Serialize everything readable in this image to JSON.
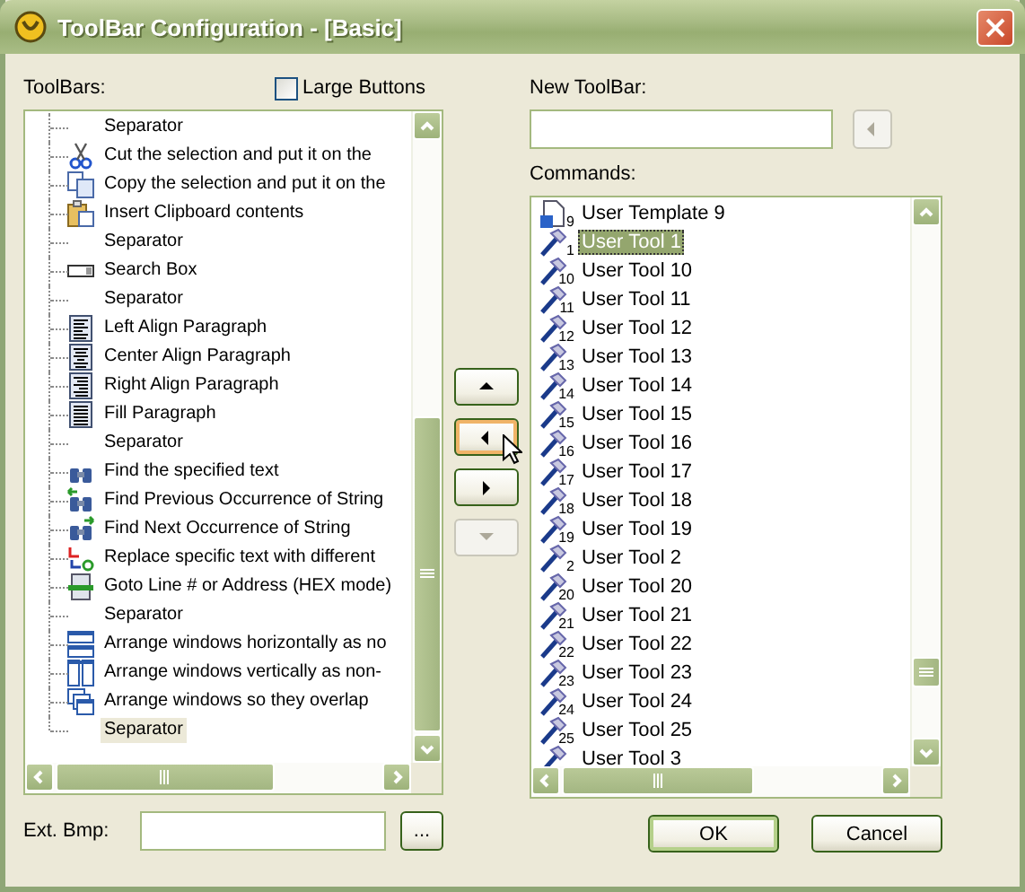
{
  "window": {
    "title": "ToolBar Configuration - [Basic]"
  },
  "toolbars": {
    "label": "ToolBars:",
    "large_buttons": {
      "label": "Large Buttons",
      "checked": false
    },
    "items": [
      {
        "kind": "separator",
        "label": "Separator",
        "selected": false
      },
      {
        "kind": "cut",
        "label": "Cut the selection and put it on the",
        "selected": false
      },
      {
        "kind": "copy",
        "label": "Copy the selection and put it on the",
        "selected": false
      },
      {
        "kind": "paste",
        "label": "Insert Clipboard contents",
        "selected": false
      },
      {
        "kind": "separator",
        "label": "Separator",
        "selected": false
      },
      {
        "kind": "searchbox",
        "label": "Search Box",
        "selected": false
      },
      {
        "kind": "separator",
        "label": "Separator",
        "selected": false
      },
      {
        "kind": "align-left",
        "label": "Left Align Paragraph",
        "selected": false
      },
      {
        "kind": "align-center",
        "label": "Center Align Paragraph",
        "selected": false
      },
      {
        "kind": "align-right",
        "label": "Right Align Paragraph",
        "selected": false
      },
      {
        "kind": "align-justify",
        "label": "Fill Paragraph",
        "selected": false
      },
      {
        "kind": "separator",
        "label": "Separator",
        "selected": false
      },
      {
        "kind": "find",
        "label": "Find the specified text",
        "selected": false
      },
      {
        "kind": "find-prev",
        "label": "Find Previous Occurrence of String",
        "selected": false
      },
      {
        "kind": "find-next",
        "label": "Find Next Occurrence of String",
        "selected": false
      },
      {
        "kind": "replace",
        "label": "Replace specific text with different",
        "selected": false
      },
      {
        "kind": "goto",
        "label": "Goto Line # or Address (HEX mode)",
        "selected": false
      },
      {
        "kind": "separator",
        "label": "Separator",
        "selected": false
      },
      {
        "kind": "tile-h",
        "label": "Arrange windows horizontally as no",
        "selected": false
      },
      {
        "kind": "tile-v",
        "label": "Arrange windows vertically as non-",
        "selected": false
      },
      {
        "kind": "cascade",
        "label": "Arrange windows so they overlap",
        "selected": false
      },
      {
        "kind": "separator",
        "label": "Separator",
        "selected": true
      }
    ]
  },
  "ext_bmp": {
    "label": "Ext. Bmp:",
    "browse": "..."
  },
  "move_buttons": [
    {
      "kind": "up",
      "hot": false,
      "disabled": false
    },
    {
      "kind": "left",
      "hot": true,
      "disabled": false
    },
    {
      "kind": "right",
      "hot": false,
      "disabled": false
    },
    {
      "kind": "down",
      "hot": false,
      "disabled": true
    }
  ],
  "new_toolbar": {
    "label": "New ToolBar:",
    "add_disabled": true
  },
  "commands": {
    "label": "Commands:",
    "items": [
      {
        "kind": "template",
        "number": "9",
        "label": "User Template 9",
        "selected": false
      },
      {
        "kind": "tool",
        "number": "1",
        "label": "User Tool 1",
        "selected": true
      },
      {
        "kind": "tool",
        "number": "10",
        "label": "User Tool 10",
        "selected": false
      },
      {
        "kind": "tool",
        "number": "11",
        "label": "User Tool 11",
        "selected": false
      },
      {
        "kind": "tool",
        "number": "12",
        "label": "User Tool 12",
        "selected": false
      },
      {
        "kind": "tool",
        "number": "13",
        "label": "User Tool 13",
        "selected": false
      },
      {
        "kind": "tool",
        "number": "14",
        "label": "User Tool 14",
        "selected": false
      },
      {
        "kind": "tool",
        "number": "15",
        "label": "User Tool 15",
        "selected": false
      },
      {
        "kind": "tool",
        "number": "16",
        "label": "User Tool 16",
        "selected": false
      },
      {
        "kind": "tool",
        "number": "17",
        "label": "User Tool 17",
        "selected": false
      },
      {
        "kind": "tool",
        "number": "18",
        "label": "User Tool 18",
        "selected": false
      },
      {
        "kind": "tool",
        "number": "19",
        "label": "User Tool 19",
        "selected": false
      },
      {
        "kind": "tool",
        "number": "2",
        "label": "User Tool 2",
        "selected": false
      },
      {
        "kind": "tool",
        "number": "20",
        "label": "User Tool 20",
        "selected": false
      },
      {
        "kind": "tool",
        "number": "21",
        "label": "User Tool 21",
        "selected": false
      },
      {
        "kind": "tool",
        "number": "22",
        "label": "User Tool 22",
        "selected": false
      },
      {
        "kind": "tool",
        "number": "23",
        "label": "User Tool 23",
        "selected": false
      },
      {
        "kind": "tool",
        "number": "24",
        "label": "User Tool 24",
        "selected": false
      },
      {
        "kind": "tool",
        "number": "25",
        "label": "User Tool 25",
        "selected": false
      },
      {
        "kind": "tool",
        "label": "User Tool 3",
        "selected": false
      }
    ]
  },
  "buttons": [
    {
      "label": "OK",
      "default": true
    },
    {
      "label": "Cancel",
      "default": false
    }
  ]
}
